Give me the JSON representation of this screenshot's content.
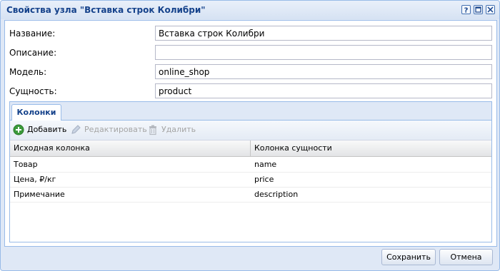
{
  "window": {
    "title": "Свойства узла \"Вставка строк Колибри\"",
    "tools": [
      "help-icon",
      "maximize-icon",
      "close-icon"
    ]
  },
  "form": {
    "name": {
      "label": "Название:",
      "value": "Вставка строк Колибри"
    },
    "description": {
      "label": "Описание:",
      "value": ""
    },
    "model": {
      "label": "Модель:",
      "value": "online_shop"
    },
    "entity": {
      "label": "Сущность:",
      "value": "product"
    }
  },
  "tabs": [
    {
      "label": "Колонки",
      "active": true
    }
  ],
  "toolbar": {
    "add": {
      "label": "Добавить",
      "icon": "add-circle-icon",
      "enabled": true
    },
    "edit": {
      "label": "Редактировать",
      "icon": "pencil-icon",
      "enabled": false
    },
    "delete": {
      "label": "Удалить",
      "icon": "trash-icon",
      "enabled": false
    }
  },
  "grid": {
    "columns": [
      "Исходная колонка",
      "Колонка сущности"
    ],
    "rows": [
      [
        "Товар",
        "name"
      ],
      [
        "Цена, ₽/кг",
        "price"
      ],
      [
        "Примечание",
        "description"
      ]
    ]
  },
  "footer": {
    "save_label": "Сохранить",
    "cancel_label": "Отмена"
  },
  "colors": {
    "title": "#15428b",
    "window_border": "#99bbe8",
    "window_bg": "#dfe8f6",
    "add_icon": "#3b9a3b",
    "disabled_text": "#a5a5a5"
  }
}
